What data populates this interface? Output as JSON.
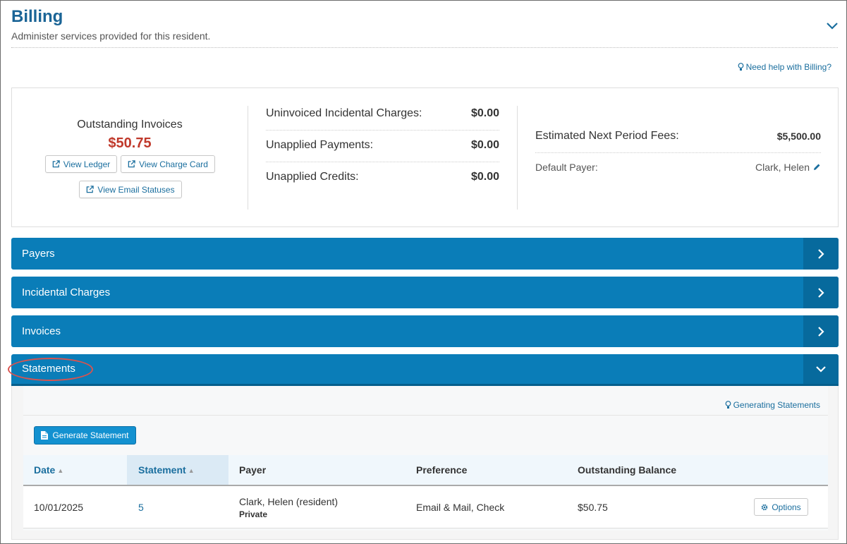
{
  "header": {
    "title": "Billing",
    "subtitle": "Administer services provided for this resident.",
    "help_link": "Need help with Billing?"
  },
  "summary": {
    "outstanding_label": "Outstanding Invoices",
    "outstanding_amount": "$50.75",
    "buttons": {
      "view_ledger": "View Ledger",
      "view_charge_card": "View Charge Card",
      "view_email_statuses": "View Email Statuses"
    },
    "middle": [
      {
        "label": "Uninvoiced Incidental Charges:",
        "value": "$0.00"
      },
      {
        "label": "Unapplied Payments:",
        "value": "$0.00"
      },
      {
        "label": "Unapplied Credits:",
        "value": "$0.00"
      }
    ],
    "right": {
      "est_label": "Estimated Next Period Fees:",
      "est_value": "$5,500.00",
      "payer_label": "Default Payer:",
      "payer_value": "Clark, Helen"
    }
  },
  "sections": [
    {
      "label": "Payers",
      "state": "collapsed"
    },
    {
      "label": "Incidental Charges",
      "state": "collapsed"
    },
    {
      "label": "Invoices",
      "state": "collapsed"
    },
    {
      "label": "Statements",
      "state": "expanded"
    }
  ],
  "statements": {
    "help_link": "Generating Statements",
    "generate_button": "Generate Statement",
    "columns": [
      "Date",
      "Statement",
      "Payer",
      "Preference",
      "Outstanding Balance"
    ],
    "rows": [
      {
        "date": "10/01/2025",
        "statement": "5",
        "payer": "Clark, Helen (resident)",
        "payer_type": "Private",
        "preference": "Email & Mail, Check",
        "balance": "$50.75",
        "options_label": "Options"
      }
    ]
  },
  "colors": {
    "accent": "#0a7db8",
    "title": "#1a6496",
    "outstanding_amount": "#c0392b",
    "annotation": "#d9534f"
  }
}
